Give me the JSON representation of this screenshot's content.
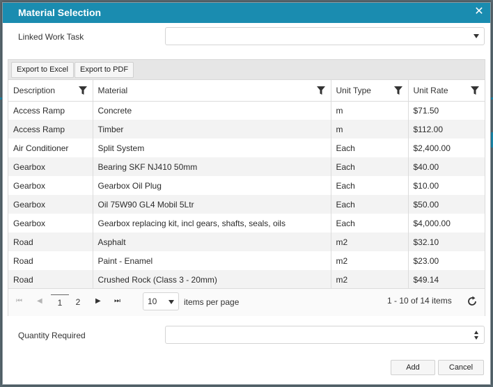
{
  "dialog": {
    "title": "Material Selection",
    "close_icon": "close-icon",
    "accent_color": "#1a8cb0"
  },
  "linked_task": {
    "label": "Linked Work Task",
    "value": ""
  },
  "toolbar": {
    "export_excel": "Export to Excel",
    "export_pdf": "Export to PDF"
  },
  "table": {
    "columns": [
      "Description",
      "Material",
      "Unit Type",
      "Unit Rate"
    ],
    "rows": [
      [
        "Access Ramp",
        "Concrete",
        "m",
        "$71.50"
      ],
      [
        "Access Ramp",
        "Timber",
        "m",
        "$112.00"
      ],
      [
        "Air Conditioner",
        "Split System",
        "Each",
        "$2,400.00"
      ],
      [
        "Gearbox",
        "Bearing SKF NJ410 50mm",
        "Each",
        "$40.00"
      ],
      [
        "Gearbox",
        "Gearbox Oil Plug",
        "Each",
        "$10.00"
      ],
      [
        "Gearbox",
        "Oil 75W90 GL4 Mobil 5Ltr",
        "Each",
        "$50.00"
      ],
      [
        "Gearbox",
        "Gearbox replacing kit, incl gears, shafts, seals, oils",
        "Each",
        "$4,000.00"
      ],
      [
        "Road",
        "Asphalt",
        "m2",
        "$32.10"
      ],
      [
        "Road",
        "Paint - Enamel",
        "m2",
        "$23.00"
      ],
      [
        "Road",
        "Crushed Rock (Class 3 - 20mm)",
        "m2",
        "$49.14"
      ]
    ]
  },
  "pager": {
    "pages": [
      "1",
      "2"
    ],
    "current_page": "1",
    "page_size": "10",
    "items_per_page_label": "items per page",
    "info": "1 - 10 of 14 items"
  },
  "quantity": {
    "label": "Quantity Required",
    "value": ""
  },
  "actions": {
    "add": "Add",
    "cancel": "Cancel"
  }
}
